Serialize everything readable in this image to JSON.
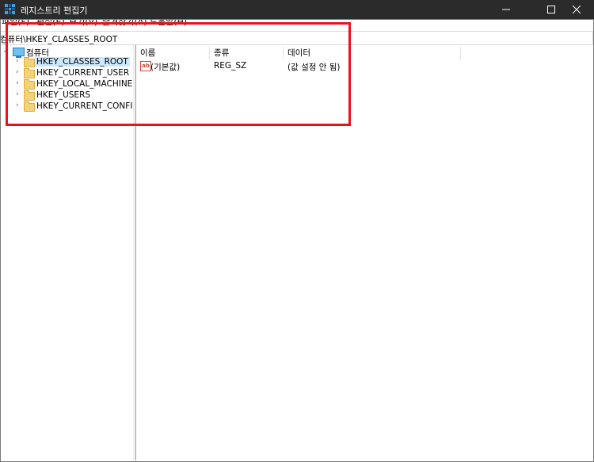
{
  "window": {
    "title": "레지스트리 편집기",
    "minimize": "─",
    "maximize": "☐",
    "close": "✕"
  },
  "menu": [
    "파일(F)",
    "편집(E)",
    "보기(V)",
    "즐겨찾기(A)",
    "도움말(H)"
  ],
  "address": "컴퓨터\\HKEY_CLASSES_ROOT",
  "tree": {
    "root": "컴퓨터",
    "items": [
      "HKEY_CLASSES_ROOT",
      "HKEY_CURRENT_USER",
      "HKEY_LOCAL_MACHINE",
      "HKEY_USERS",
      "HKEY_CURRENT_CONFIG"
    ],
    "selected_index": 0
  },
  "columns": [
    "이름",
    "종류",
    "데이터"
  ],
  "values": [
    {
      "name": "(기본값)",
      "type": "REG_SZ",
      "data": "(값 설정 안 됨)",
      "icon": "ab"
    }
  ],
  "colors": {
    "highlight": "#e8141b",
    "selection": "#cce8ff",
    "titlebar": "#2b2b2b"
  }
}
